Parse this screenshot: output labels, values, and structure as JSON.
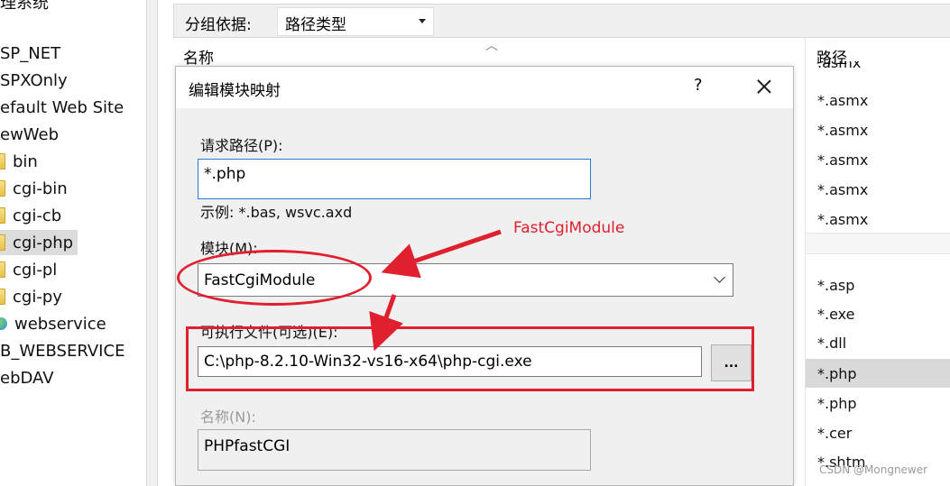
{
  "tree": {
    "items": [
      {
        "label": "理系统",
        "icon": ""
      },
      {
        "label": "SP_NET",
        "icon": ""
      },
      {
        "label": "SPXOnly",
        "icon": ""
      },
      {
        "label": "efault Web Site",
        "icon": ""
      },
      {
        "label": "ewWeb",
        "icon": ""
      },
      {
        "label": "bin",
        "icon": "folder-icon"
      },
      {
        "label": "cgi-bin",
        "icon": "folder-icon"
      },
      {
        "label": "cgi-cb",
        "icon": "folder-icon"
      },
      {
        "label": "cgi-php",
        "icon": "folder-icon",
        "selected": true
      },
      {
        "label": "cgi-pl",
        "icon": "folder-icon"
      },
      {
        "label": "cgi-py",
        "icon": "folder-icon"
      },
      {
        "label": "webservice",
        "icon": "globe-icon"
      },
      {
        "label": "B_WEBSERVICE",
        "icon": ""
      },
      {
        "label": "ebDAV",
        "icon": ""
      }
    ]
  },
  "groupbar": {
    "label": "分组依据:",
    "selected": "路径类型"
  },
  "list": {
    "name_header": "名称",
    "path_header": "路径",
    "paths": [
      ".asmx",
      "*.asmx",
      "*.asmx",
      "*.asmx",
      "*.asmx",
      "*.asmx",
      "*.asp",
      "*.exe",
      "*.dll",
      "*.php",
      "*.php",
      "*.cer",
      "*.shtm"
    ]
  },
  "dialog": {
    "title": "编辑模块映射",
    "help": "?",
    "request_path_label": "请求路径(P):",
    "request_path_value": "*.php",
    "example_text": "示例: *.bas, wsvc.axd",
    "module_label": "模块(M):",
    "module_value": "FastCgiModule",
    "executable_label": "可执行文件(可选)(E):",
    "executable_value": "C:\\php-8.2.10-Win32-vs16-x64\\php-cgi.exe",
    "browse_label": "...",
    "name_label": "名称(N):",
    "name_value": "PHPfastCGI"
  },
  "annotation": {
    "text": "FastCgiModule",
    "color": "#e0202e"
  },
  "watermark": "CSDN @Mongnewer"
}
